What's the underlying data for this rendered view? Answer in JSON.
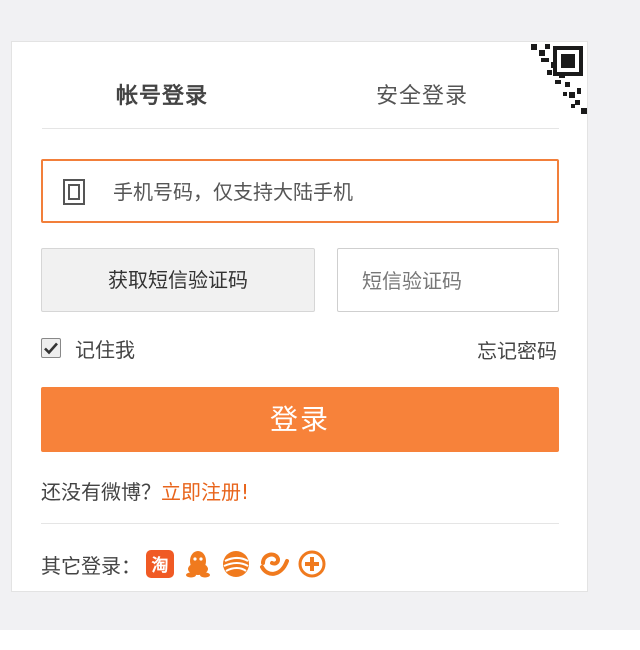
{
  "tabs": {
    "account_login": "帐号登录",
    "secure_login": "安全登录"
  },
  "phone": {
    "placeholder": "手机号码，仅支持大陆手机"
  },
  "sms": {
    "button_label": "获取短信验证码",
    "code_placeholder": "短信验证码"
  },
  "remember": {
    "label": "记住我",
    "checked": true
  },
  "forgot_password": "忘记密码",
  "login_button": "登录",
  "register": {
    "prompt": "还没有微博？",
    "link": "立即注册!"
  },
  "other_login": {
    "label": "其它登录：",
    "providers": [
      {
        "name": "taobao-icon",
        "glyph": "淘"
      },
      {
        "name": "qq-icon"
      },
      {
        "name": "china-mobile-icon"
      },
      {
        "name": "tianyi-icon"
      },
      {
        "name": "add-icon"
      }
    ]
  },
  "colors": {
    "accent": "#f7823a",
    "link": "#e8641b",
    "focus_border": "#f27f3a"
  }
}
